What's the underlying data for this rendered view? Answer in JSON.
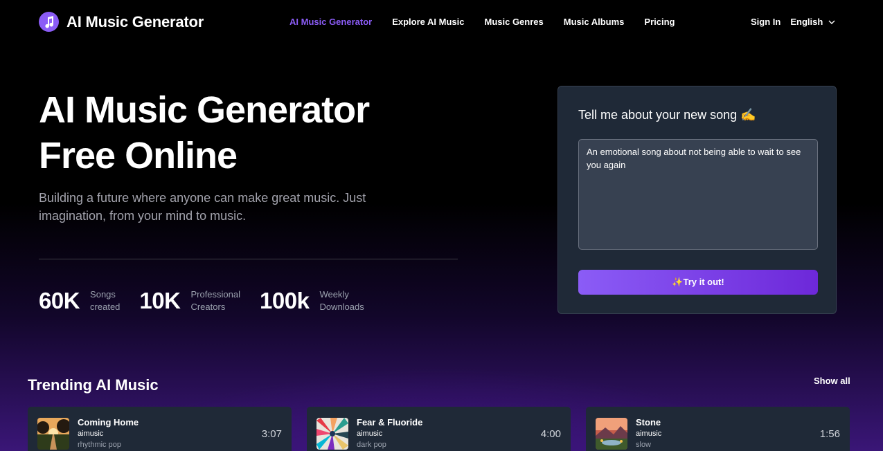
{
  "brand": {
    "name": "AI Music Generator",
    "logo_icon": "music-note-icon",
    "accent": "#8b5cf6"
  },
  "nav": {
    "items": [
      {
        "label": "AI Music Generator",
        "active": true
      },
      {
        "label": "Explore AI Music",
        "active": false
      },
      {
        "label": "Music Genres",
        "active": false
      },
      {
        "label": "Music Albums",
        "active": false
      },
      {
        "label": "Pricing",
        "active": false
      }
    ],
    "sign_in": "Sign In",
    "language": "English"
  },
  "hero": {
    "title_line1": "AI Music Generator",
    "title_line2": "Free Online",
    "subtitle": "Building a future where anyone can make great music. Just imagination, from your mind to music.",
    "stats": [
      {
        "value": "60K",
        "label_line1": "Songs",
        "label_line2": "created"
      },
      {
        "value": "10K",
        "label_line1": "Professional",
        "label_line2": "Creators"
      },
      {
        "value": "100k",
        "label_line1": "Weekly",
        "label_line2": "Downloads"
      }
    ]
  },
  "prompt_card": {
    "title": "Tell me about your new song ✍️",
    "textarea_value": "An emotional song about not being able to wait to see you again",
    "button_label": "✨Try it out!"
  },
  "trending": {
    "title": "Trending AI Music",
    "show_all": "Show all",
    "tracks": [
      {
        "name": "Coming Home",
        "artist": "aimusic",
        "genre": "rhythmic pop",
        "duration": "3:07"
      },
      {
        "name": "Fear & Fluoride",
        "artist": "aimusic",
        "genre": "dark pop",
        "duration": "4:00"
      },
      {
        "name": "Stone",
        "artist": "aimusic",
        "genre": "slow",
        "duration": "1:56"
      }
    ]
  }
}
